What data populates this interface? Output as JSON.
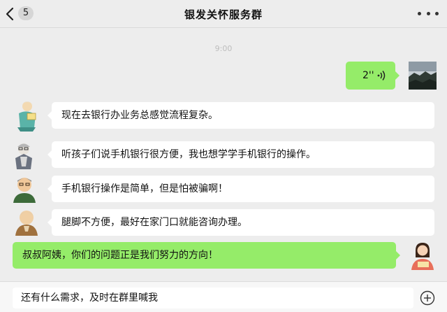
{
  "header": {
    "unread_count": "5",
    "title": "银发关怀服务群"
  },
  "chat": {
    "timestamp": "9:00",
    "voice_message": {
      "duration": "2''"
    },
    "messages": [
      {
        "text": "现在去银行办业务总感觉流程复杂。"
      },
      {
        "text": "听孩子们说手机银行很方便，我也想学学手机银行的操作。"
      },
      {
        "text": "手机银行操作是简单，但是怕被骗啊！"
      },
      {
        "text": "腿脚不方便，最好在家门口就能咨询办理。"
      },
      {
        "text": "叔叔阿姨，你们的问题正是我们努力的方向！"
      }
    ]
  },
  "input": {
    "value": "还有什么需求，及时在群里喊我"
  },
  "colors": {
    "my_bubble": "#95ec69",
    "other_bubble": "#ffffff",
    "background": "#ededed"
  },
  "icons": [
    "back-arrow-icon",
    "more-icon",
    "voice-wave-icon",
    "plus-icon"
  ]
}
